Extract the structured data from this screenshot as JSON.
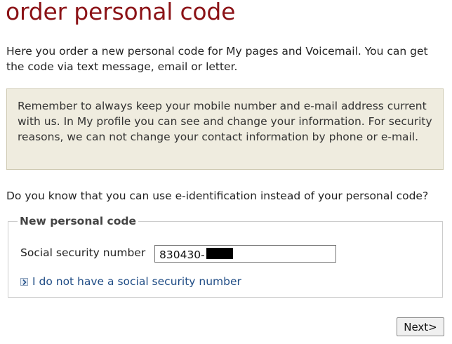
{
  "page": {
    "title": "order personal code",
    "intro": "Here you order a new personal code for My pages and Voicemail. You can get the code via text message, email or letter."
  },
  "notice": {
    "text": "Remember to always keep your mobile number and e-mail address current with us. In My profile you can see and change your information. For security reasons, we can not change your contact information by phone or e-mail."
  },
  "eid_question": "Do you know that you can use e-identification instead of your personal code?",
  "form": {
    "legend": "New personal code",
    "ssn_label": "Social security number",
    "ssn_value": "830430-",
    "ssn_redacted": true,
    "no_ssn_link": "I do not have a social security number",
    "link_icon": "arrow-right-icon"
  },
  "actions": {
    "next_label": "Next>"
  },
  "colors": {
    "title": "#8b1216",
    "notice_background": "#efecdf",
    "link": "#1f4c85"
  }
}
